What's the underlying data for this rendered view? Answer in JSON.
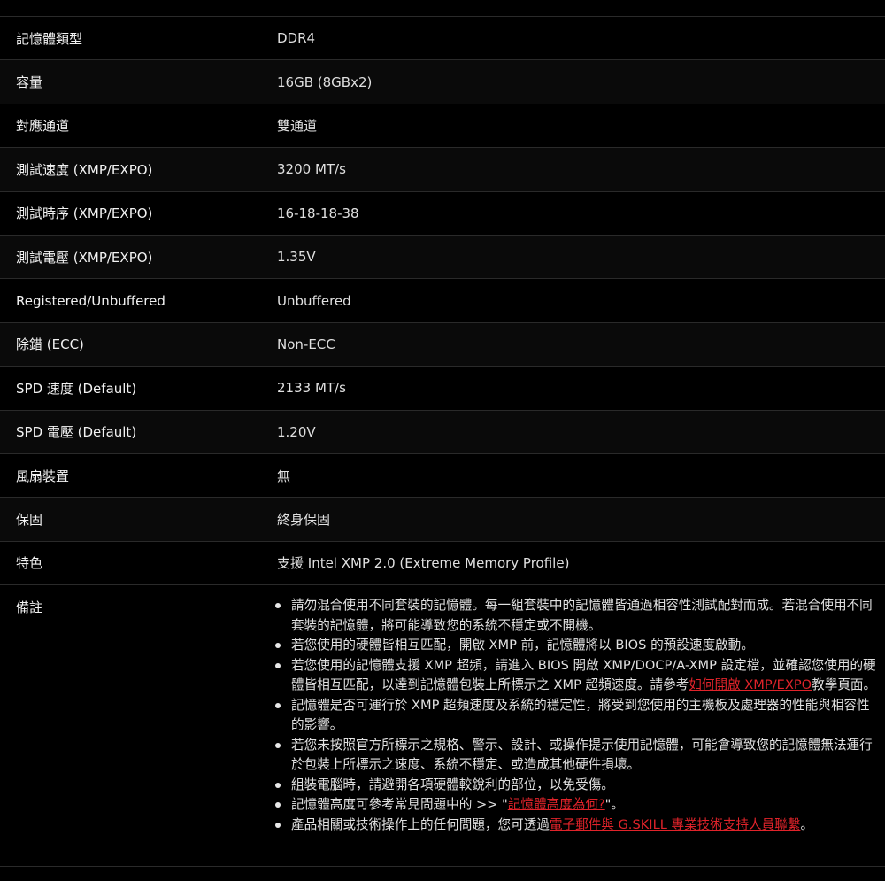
{
  "specs": [
    {
      "label": "記憶體類型",
      "value": "DDR4"
    },
    {
      "label": "容量",
      "value": "16GB (8GBx2)"
    },
    {
      "label": "對應通道",
      "value": "雙通道"
    },
    {
      "label": "測試速度 (XMP/EXPO)",
      "value": "3200 MT/s"
    },
    {
      "label": "測試時序 (XMP/EXPO)",
      "value": "16-18-18-38"
    },
    {
      "label": "測試電壓 (XMP/EXPO)",
      "value": "1.35V"
    },
    {
      "label": "Registered/Unbuffered",
      "value": "Unbuffered"
    },
    {
      "label": "除錯 (ECC)",
      "value": "Non-ECC"
    },
    {
      "label": "SPD 速度 (Default)",
      "value": "2133 MT/s"
    },
    {
      "label": "SPD 電壓 (Default)",
      "value": "1.20V"
    },
    {
      "label": "風扇裝置",
      "value": "無"
    },
    {
      "label": "保固",
      "value": "終身保固"
    },
    {
      "label": "特色",
      "value": "支援 Intel XMP 2.0 (Extreme Memory Profile)"
    }
  ],
  "remarks": {
    "label": "備註",
    "notes": [
      {
        "text": "請勿混合使用不同套裝的記憶體。每一組套裝中的記憶體皆通過相容性測試配對而成。若混合使用不同套裝的記憶體，將可能導致您的系統不穩定或不開機。"
      },
      {
        "text": "若您使用的硬體皆相互匹配，開啟 XMP 前，記憶體將以 BIOS 的預設速度啟動。"
      },
      {
        "pre": "若您使用的記憶體支援 XMP 超頻，請進入 BIOS 開啟 XMP/DOCP/A-XMP 設定檔，並確認您使用的硬體皆相互匹配，以達到記憶體包裝上所標示之 XMP 超頻速度。請參考",
        "link": "如何開啟 XMP/EXPO",
        "post": "教學頁面。"
      },
      {
        "text": "記憶體是否可運行於 XMP 超頻速度及系統的穩定性，將受到您使用的主機板及處理器的性能與相容性的影響。"
      },
      {
        "text": "若您未按照官方所標示之規格、警示、設計、或操作提示使用記憶體，可能會導致您的記憶體無法運行於包裝上所標示之速度、系統不穩定、或造成其他硬件損壞。"
      },
      {
        "text": "組裝電腦時，請避開各項硬體較銳利的部位，以免受傷。"
      },
      {
        "pre": "記憶體高度可參考常見問題中的 >> \"",
        "link": "記憶體高度為何?",
        "post": "\"。"
      },
      {
        "pre": "產品相關或技術操作上的任何問題，您可透過",
        "link": "電子郵件與 G.SKILL 專業技術支持人員聯繫",
        "post": "。"
      }
    ]
  }
}
